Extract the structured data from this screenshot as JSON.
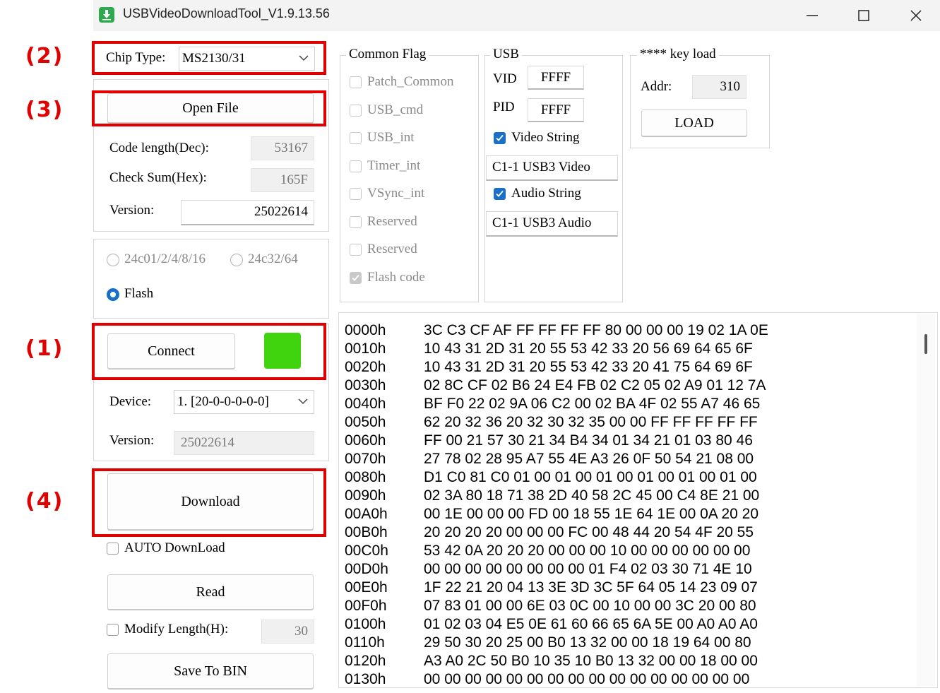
{
  "window": {
    "title": "USBVideoDownloadTool_V1.9.13.56"
  },
  "annotations": {
    "a2": "(2)",
    "a3": "(3)",
    "a1": "(1)",
    "a4": "(4)",
    "color": "#e00000"
  },
  "chip": {
    "label": "Chip Type:",
    "value": "MS2130/31"
  },
  "file": {
    "open_button": "Open File",
    "code_length_label": "Code length(Dec):",
    "code_length_value": "53167",
    "checksum_label": "Check Sum(Hex):",
    "checksum_value": "165F",
    "version_label": "Version:",
    "version_value": "25022614"
  },
  "memory": {
    "radio1": "24c01/2/4/8/16",
    "radio2": "24c32/64",
    "radio3": "Flash",
    "selected": "Flash"
  },
  "connection": {
    "connect_button": "Connect",
    "status_color": "#3fd40d",
    "device_label": "Device:",
    "device_value": "1. [20-0-0-0-0-0]",
    "version_label": "Version:",
    "version_value": "25022614"
  },
  "actions": {
    "download_button": "Download",
    "auto_download": "AUTO DownLoad",
    "read_button": "Read",
    "modify_length_label": "Modify Length(H):",
    "modify_length_value": "30",
    "save_button": "Save To BIN"
  },
  "common_flag": {
    "title": "Common Flag",
    "items": [
      {
        "label": "Patch_Common",
        "checked": false
      },
      {
        "label": "USB_cmd",
        "checked": false
      },
      {
        "label": "USB_int",
        "checked": false
      },
      {
        "label": "Timer_int",
        "checked": false
      },
      {
        "label": "VSync_int",
        "checked": false
      },
      {
        "label": "Reserved",
        "checked": false
      },
      {
        "label": "Reserved",
        "checked": false
      },
      {
        "label": "Flash code",
        "checked": true
      }
    ]
  },
  "usb": {
    "title": "USB",
    "vid_label": "VID",
    "vid_value": "FFFF",
    "pid_label": "PID",
    "pid_value": "FFFF",
    "video_string_label": "Video String",
    "video_string_value": "C1-1 USB3 Video",
    "audio_string_label": "Audio String",
    "audio_string_value": "C1-1 USB3 Audio"
  },
  "keyload": {
    "title": "**** key load",
    "addr_label": "Addr:",
    "addr_value": "310",
    "load_button": "LOAD"
  },
  "hex": {
    "rows": [
      {
        "addr": "0000h",
        "bytes": "3C C3 CF AF FF FF FF FF 80 00 00 00 19 02 1A 0E"
      },
      {
        "addr": "0010h",
        "bytes": "10 43 31 2D 31 20 55 53 42 33 20 56 69 64 65 6F"
      },
      {
        "addr": "0020h",
        "bytes": "10 43 31 2D 31 20 55 53 42 33 20 41 75 64 69 6F"
      },
      {
        "addr": "0030h",
        "bytes": "02 8C CF 02 B6 24 E4 FB 02 C2 05 02 A9 01 12 7A"
      },
      {
        "addr": "0040h",
        "bytes": "BF F0 22 02 9A 06 C2 00 02 BA 4F 02 55 A7 46 65"
      },
      {
        "addr": "0050h",
        "bytes": "62 20 32 36 20 32 30 32 35 00 00 FF FF FF FF FF"
      },
      {
        "addr": "0060h",
        "bytes": "FF 00 21 57 30 21 34 B4 34 01 34 21 01 03 80 46"
      },
      {
        "addr": "0070h",
        "bytes": "27 78 02 28 95 A7 55 4E A3 26 0F 50 54 21 08 00"
      },
      {
        "addr": "0080h",
        "bytes": "D1 C0 81 C0 01 00 01 00 01 00 01 00 01 00 01 00"
      },
      {
        "addr": "0090h",
        "bytes": "02 3A 80 18 71 38 2D 40 58 2C 45 00 C4 8E 21 00"
      },
      {
        "addr": "00A0h",
        "bytes": "00 1E 00 00 00 FD 00 18 55 1E 64 1E 00 0A 20 20"
      },
      {
        "addr": "00B0h",
        "bytes": "20 20 20 20 00 00 00 FC 00 48 44 20 54 4F 20 55"
      },
      {
        "addr": "00C0h",
        "bytes": "53 42 0A 20 20 20 00 00 00 10 00 00 00 00 00 00"
      },
      {
        "addr": "00D0h",
        "bytes": "00 00 00 00 00 00 00 00 01 F4 02 03 30 71 4E 10"
      },
      {
        "addr": "00E0h",
        "bytes": "1F 22 21 20 04 13 3E 3D 3C 5F 64 05 14 23 09 07"
      },
      {
        "addr": "00F0h",
        "bytes": "07 83 01 00 00 6E 03 0C 00 10 00 00 3C 20 00 80"
      },
      {
        "addr": "0100h",
        "bytes": "01 02 03 04 E5 0E 61 60 66 65 6A 5E 00 A0 A0 A0"
      },
      {
        "addr": "0110h",
        "bytes": "29 50 30 20 25 00 B0 13 32 00 00 18 19 64 00 80"
      },
      {
        "addr": "0120h",
        "bytes": "A3 A0 2C 50 B0 10 35 10 B0 13 32 00 00 18 00 00"
      },
      {
        "addr": "0130h",
        "bytes": "00 00 00 00 00 00 00 00 00 00 00 00 00 00 00 00"
      }
    ]
  }
}
